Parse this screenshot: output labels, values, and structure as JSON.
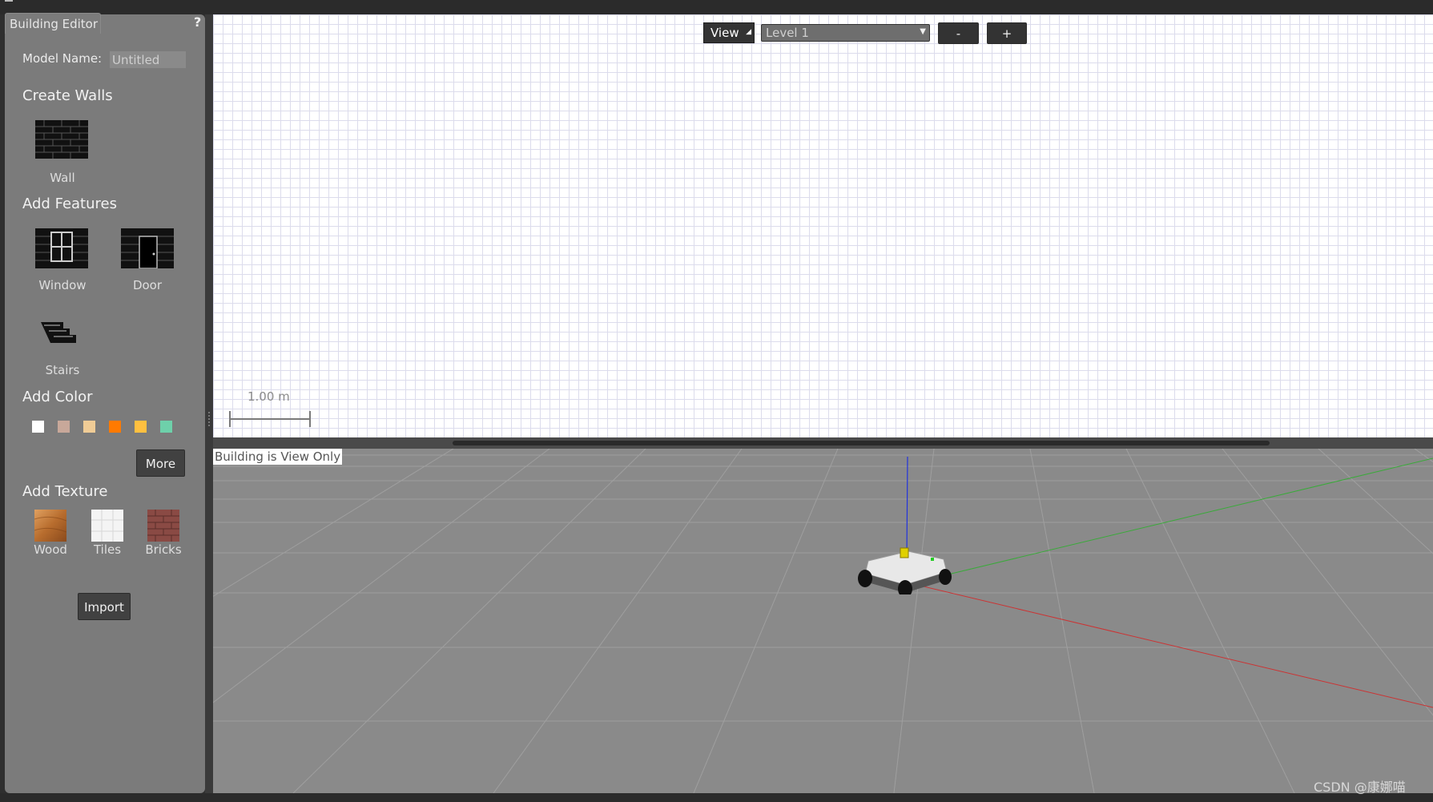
{
  "window": {
    "title": "Building Editor",
    "help": "?"
  },
  "panel": {
    "model_name_label": "Model Name:",
    "model_name_value": "Untitled",
    "sections": {
      "walls": "Create Walls",
      "features": "Add Features",
      "color": "Add Color",
      "texture": "Add Texture"
    },
    "wall_label": "Wall",
    "window_label": "Window",
    "door_label": "Door",
    "stairs_label": "Stairs",
    "colors": [
      "#ffffff",
      "#c8a89a",
      "#f0cc96",
      "#ff7a00",
      "#ffc040",
      "#6ed0aa"
    ],
    "more_button": "More",
    "textures": [
      "Wood",
      "Tiles",
      "Bricks"
    ],
    "import_button": "Import"
  },
  "editor": {
    "view_button": "View",
    "level_value": "Level 1",
    "zoom_out": "-",
    "zoom_in": "+",
    "scale_label": "1.00 m"
  },
  "viewport": {
    "status": "Building is View Only"
  },
  "watermark": "CSDN @康娜喵"
}
